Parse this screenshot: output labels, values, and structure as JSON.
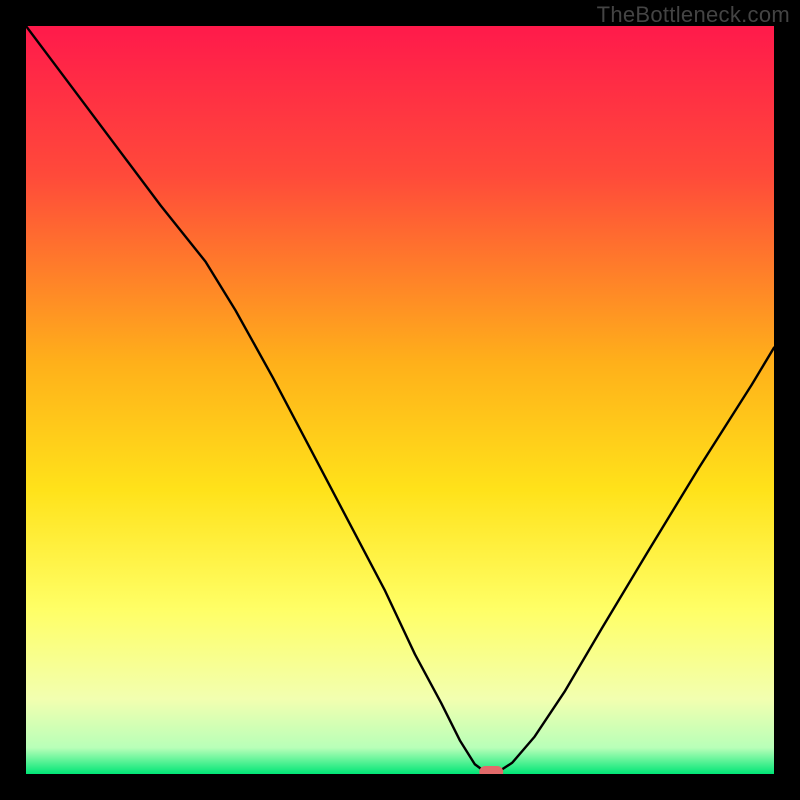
{
  "watermark": "TheBottleneck.com",
  "chart_data": {
    "type": "line",
    "title": "",
    "xlabel": "",
    "ylabel": "",
    "xlim": [
      0,
      100
    ],
    "ylim": [
      0,
      100
    ],
    "grid": false,
    "legend": false,
    "gradient_stops": [
      {
        "offset": 0.0,
        "color": "#ff1a4b"
      },
      {
        "offset": 0.2,
        "color": "#ff4a3a"
      },
      {
        "offset": 0.45,
        "color": "#ffb01a"
      },
      {
        "offset": 0.62,
        "color": "#ffe21a"
      },
      {
        "offset": 0.78,
        "color": "#ffff66"
      },
      {
        "offset": 0.9,
        "color": "#f2ffb0"
      },
      {
        "offset": 0.965,
        "color": "#b8ffb8"
      },
      {
        "offset": 1.0,
        "color": "#00e676"
      }
    ],
    "series": [
      {
        "name": "bottleneck-curve",
        "color": "#000000",
        "x": [
          0.0,
          6.0,
          12.0,
          18.0,
          24.0,
          28.0,
          33.0,
          38.0,
          43.0,
          48.0,
          52.0,
          55.5,
          58.0,
          60.0,
          61.5,
          63.0,
          65.0,
          68.0,
          72.0,
          77.0,
          83.0,
          90.0,
          97.0,
          100.0
        ],
        "y": [
          100.0,
          92.0,
          84.0,
          76.0,
          68.5,
          62.0,
          53.0,
          43.5,
          34.0,
          24.5,
          16.0,
          9.5,
          4.5,
          1.3,
          0.2,
          0.2,
          1.5,
          5.0,
          11.0,
          19.5,
          29.5,
          41.0,
          52.0,
          57.0
        ]
      }
    ],
    "marker": {
      "name": "optimal-point",
      "x": 62.2,
      "y": 0.0,
      "width": 3.2,
      "height": 1.6,
      "color": "#e26a6a"
    }
  }
}
